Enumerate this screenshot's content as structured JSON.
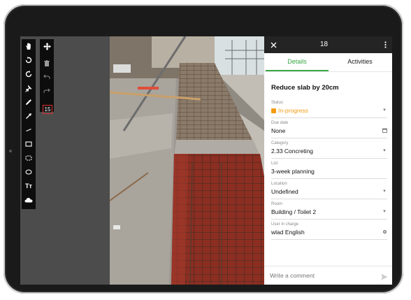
{
  "toolbar_tools": [
    {
      "icon": "hand-icon"
    },
    {
      "icon": "rotate-ccw-icon"
    },
    {
      "icon": "rotate-cw-icon"
    },
    {
      "icon": "pin-icon"
    },
    {
      "icon": "pencil-icon"
    },
    {
      "icon": "arrow-icon"
    },
    {
      "icon": "line-icon"
    },
    {
      "icon": "rectangle-icon"
    },
    {
      "icon": "cloud-rect-icon"
    },
    {
      "icon": "ellipse-icon"
    },
    {
      "icon": "text-tool-icon",
      "label": "Tт"
    },
    {
      "icon": "cloud-icon"
    }
  ],
  "secondary_toolbar": {
    "page_number": "15"
  },
  "panel": {
    "header_title": "18",
    "tabs": [
      "Details",
      "Activities"
    ],
    "task_title": "Reduce slab by 20cm",
    "fields": {
      "status": {
        "label": "Status",
        "value": "In-progress",
        "color": "#f39c12"
      },
      "due_date": {
        "label": "Due date",
        "value": "None"
      },
      "category": {
        "label": "Category",
        "value": "2.33 Concreting"
      },
      "list": {
        "label": "List",
        "value": "3-week planning"
      },
      "location": {
        "label": "Location",
        "value": "Undefined"
      },
      "room": {
        "label": "Room",
        "value": "Building / Toilet 2"
      },
      "user": {
        "label": "User in charge",
        "value": "wlad English"
      }
    },
    "comment_placeholder": "Write a comment"
  },
  "colors": {
    "accent": "#3aa845",
    "status": "#f39c12",
    "header": "#242424"
  }
}
